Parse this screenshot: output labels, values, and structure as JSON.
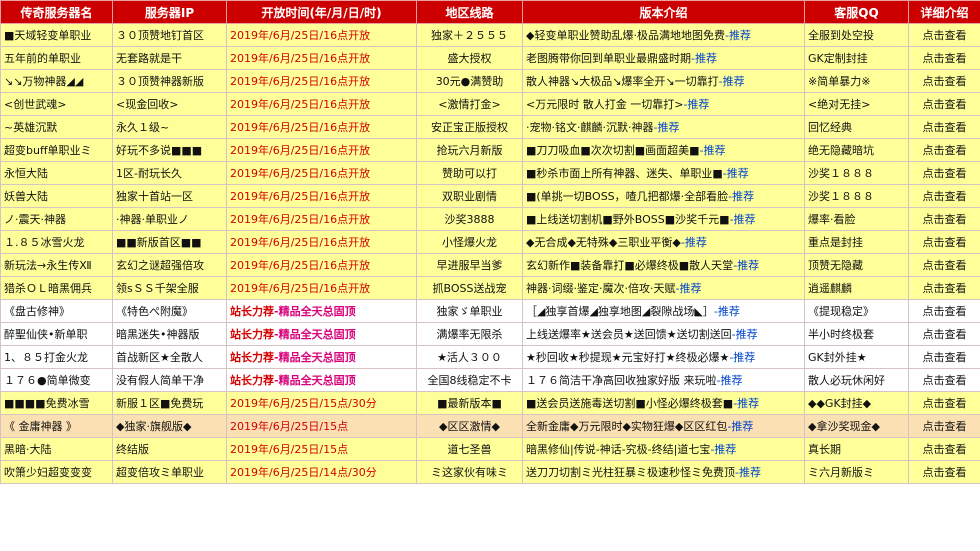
{
  "headers": [
    "传奇服务器名",
    "服务器IP",
    "开放时间(年/月/日/时)",
    "地区线路",
    "版本介绍",
    "客服QQ",
    "详细介绍"
  ],
  "recommend_label": "-推荐",
  "detail_label": "点击查看",
  "rows": [
    {
      "style": "yellow",
      "name": "■天域轻变单职业",
      "ip": "３０顶赞地钉首区",
      "time": "2019年/6月/25日/16点开放",
      "line": "独家＋２５５５",
      "ver": "◆轻变单职业赞助乱爆·极品满地地图免费",
      "qq": "全服到处空投"
    },
    {
      "style": "yellow",
      "name": "五年前的单职业",
      "ip": "无套路就是干",
      "time": "2019年/6月/25日/16点开放",
      "line": "盛大授权",
      "ver": "老图腾带你回到单职业最鼎盛时期",
      "qq": "GK定制封挂"
    },
    {
      "style": "yellow",
      "name": "↘↘万物神器◢◢",
      "ip": "３０顶赞神器新版",
      "time": "2019年/6月/25日/16点开放",
      "line": "30元●满赞助",
      "ver": "散人神器↘大极品↘爆率全开↘一切靠打",
      "qq": "※简单暴力※"
    },
    {
      "style": "yellow",
      "name": "<创世武魂>",
      "ip": "<现金回收>",
      "time": "2019年/6月/25日/16点开放",
      "line": "<激情打金>",
      "ver": "<万元限时 散人打金 一切靠打>",
      "qq": "<绝对无挂>"
    },
    {
      "style": "yellow",
      "name": "~英雄沉默",
      "ip": "永久１级~",
      "time": "2019年/6月/25日/16点开放",
      "line": "安正宝正版授权",
      "ver": "·宠物·铭文·麒麟·沉默·神器",
      "qq": "回忆经典"
    },
    {
      "style": "yellow",
      "name": "超变buff单职业ミ",
      "ip": "好玩不多说■■■",
      "time": "2019年/6月/25日/16点开放",
      "line": "抢玩六月新版",
      "ver": "■刀刀吸血■次次切割■画面超美■",
      "qq": "绝无隐藏暗坑"
    },
    {
      "style": "yellow",
      "name": "永恒大陆",
      "ip": "1区-耐玩长久",
      "time": "2019年/6月/25日/16点开放",
      "line": "赞助可以打",
      "ver": "■秒杀市面上所有神器、迷失、单职业■",
      "qq": "沙奖１８８８"
    },
    {
      "style": "yellow",
      "name": "妖兽大陆",
      "ip": "独家十首站一区",
      "time": "2019年/6月/25日/16点开放",
      "line": "双职业剧情",
      "ver": "■(单挑一切BOSS，喳几把都爆·全部看脸",
      "qq": "沙奖１８８８"
    },
    {
      "style": "yellow",
      "name": "ノ·震天·神器",
      "ip": "·神器·单职业ノ",
      "time": "2019年/6月/25日/16点开放",
      "line": "沙奖3888",
      "ver": "■上线送切割机■野外BOSS■沙奖千元■",
      "qq": "爆率·看脸"
    },
    {
      "style": "yellow",
      "name": "１.８５冰雪火龙",
      "ip": "■■新版首区■■",
      "time": "2019年/6月/25日/16点开放",
      "line": "小怪爆火龙",
      "ver": "◆无合成◆无特殊◆三职业平衡◆",
      "qq": "重点是封挂"
    },
    {
      "style": "yellow",
      "name": "新玩法→永生传Ⅻ",
      "ip": "玄幻之谜超强倍攻",
      "time": "2019年/6月/25日/16点开放",
      "line": "早进服早当爹",
      "ver": "玄幻新作■装备靠打■必爆终极■散人天堂",
      "qq": "顶赞无隐藏"
    },
    {
      "style": "yellow",
      "name": "猎杀ＯＬ暗黑佣兵",
      "ip": "领sＳＳ千架全服",
      "time": "2019年/6月/25日/16点开放",
      "line": "抓BOSS送战宠",
      "ver": "神器·词缀·鉴定·魔次·倍攻·天赋",
      "qq": "逍遥麒麟"
    },
    {
      "style": "white",
      "promo": true,
      "name": "《盘古修神》",
      "ip": "《特色ぺ附魔》",
      "time_a": "站长力荐",
      "time_b": "-精品全天总固顶",
      "line": "独家ゞ单职业",
      "ver": "［◢独享首爆◢独享地图◢裂隙战场◣］",
      "qq": "《提现稳定》"
    },
    {
      "style": "white",
      "promo": true,
      "name": "醉聖仙侠•新单职",
      "ip": "暗黑迷失•神器版",
      "time_a": "站长力荐",
      "time_b": "-精品全天总固顶",
      "line": "满爆率无限杀",
      "ver": "上线送爆率★送会员★送回馈★送切割送回",
      "qq": "半小时终极套"
    },
    {
      "style": "white",
      "promo": true,
      "name": "1、８５打金火龙",
      "ip": "首战新区★全散人",
      "time_a": "站长力荐",
      "time_b": "-精品全天总固顶",
      "line": "★活人３００",
      "ver": "★秒回收★秒提现★元宝好打★终极必爆★",
      "qq": "GK封外挂★"
    },
    {
      "style": "white",
      "promo": true,
      "name": "１７６●简单微变",
      "ip": "没有假人简单干净",
      "time_a": "站长力荐",
      "time_b": "-精品全天总固顶",
      "line": "全国8线稳定不卡",
      "ver": "１７６简洁干净高回收独家好版 来玩啦",
      "qq": "散人必玩休闲好"
    },
    {
      "style": "yellow",
      "name": "■■■■免费冰雪",
      "ip": "新服１区■免费玩",
      "time": "2019年/6月/25日/15点/30分",
      "line": "■最新版本■",
      "ver": "■送会员送施毒送切割■小怪必爆终极套■",
      "qq": "◆◆GK封挂◆"
    },
    {
      "style": "orange",
      "name": "《 金庸神器 》",
      "ip": "◆独家·旗舰版◆",
      "time": "2019年/6月/25日/15点",
      "line": "◆区区激情◆",
      "ver": "全新金庸◆万元限时◆实物狂爆◆区区红包",
      "qq": "◆拿沙奖现金◆"
    },
    {
      "style": "yellow",
      "name": "黑暗·大陆",
      "ip": "终结版",
      "time": "2019年/6月/25日/15点",
      "line": "道七圣兽",
      "ver": "暗黑修仙|传说-神话-究极-终结|道七宝",
      "qq": "真长期"
    },
    {
      "style": "yellow",
      "name": "吹箫少妇超变变变",
      "ip": "超变倍攻ミ单职业",
      "time": "2019年/6月/25日/14点/30分",
      "line": "ミ这家伙有味ミ",
      "ver": "送刀刀切割ミ光柱狂暴ミ极速秒怪ミ免费顶",
      "qq": "ミ六月新版ミ"
    }
  ]
}
